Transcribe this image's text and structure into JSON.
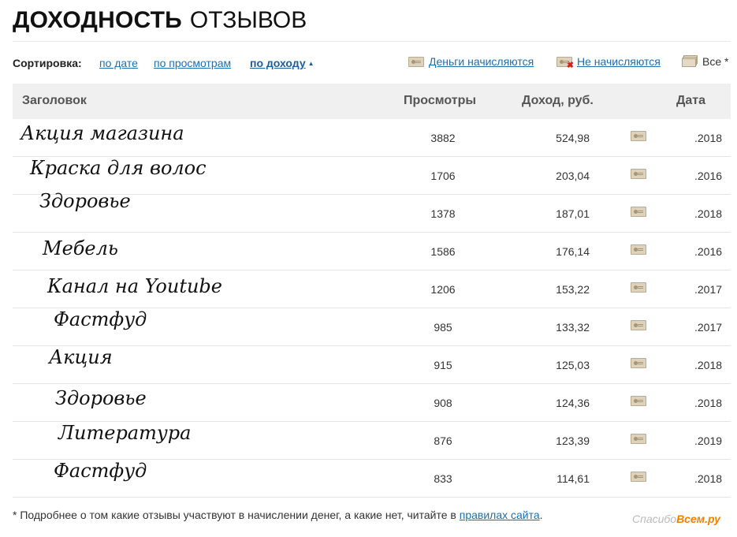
{
  "header": {
    "title_bold": "ДОХОДНОСТЬ",
    "title_light": "ОТЗЫВОВ"
  },
  "sort": {
    "label": "Сортировка:",
    "by_date": "по дате",
    "by_views": "по просмотрам",
    "by_income": "по доходу",
    "active": "by_income"
  },
  "filters": {
    "paid": "Деньги начисляются",
    "unpaid": "Не начисляются",
    "all": "Все *"
  },
  "table": {
    "columns": {
      "title": "Заголовок",
      "views": "Просмотры",
      "income": "Доход, руб.",
      "date": "Дата"
    },
    "rows": [
      {
        "title": "Акция магазина",
        "views": "3882",
        "income": "524,98",
        "date": ".2018",
        "status_icon": "money-icon"
      },
      {
        "title": "Краска для волос",
        "views": "1706",
        "income": "203,04",
        "date": ".2016",
        "status_icon": "money-icon"
      },
      {
        "title": "Здоровье",
        "views": "1378",
        "income": "187,01",
        "date": ".2018",
        "status_icon": "money-icon"
      },
      {
        "title": "Мебель",
        "views": "1586",
        "income": "176,14",
        "date": ".2016",
        "status_icon": "money-icon"
      },
      {
        "title": "Канал на Youtube",
        "views": "1206",
        "income": "153,22",
        "date": ".2017",
        "status_icon": "money-icon"
      },
      {
        "title": "Фастфуд",
        "views": "985",
        "income": "133,32",
        "date": ".2017",
        "status_icon": "money-icon"
      },
      {
        "title": "Акция",
        "views": "915",
        "income": "125,03",
        "date": ".2018",
        "status_icon": "money-icon"
      },
      {
        "title": "Здоровье",
        "views": "908",
        "income": "124,36",
        "date": ".2018",
        "status_icon": "money-icon"
      },
      {
        "title": "Литература",
        "views": "876",
        "income": "123,39",
        "date": ".2019",
        "status_icon": "money-icon"
      },
      {
        "title": "Фастфуд",
        "views": "833",
        "income": "114,61",
        "date": ".2018",
        "status_icon": "money-icon"
      }
    ]
  },
  "footer": {
    "note": "* Подробнее о том какие отзывы участвуют в начислении денег, а какие нет, читайте в",
    "link": "правилах сайта",
    "end": "."
  },
  "watermark": {
    "prefix": "Спасибо",
    "brand": "Всем.ру"
  },
  "colors": {
    "link": "#1b6fb3",
    "header_bg": "#f0f0f0",
    "unpaid_mark": "#d02020"
  }
}
